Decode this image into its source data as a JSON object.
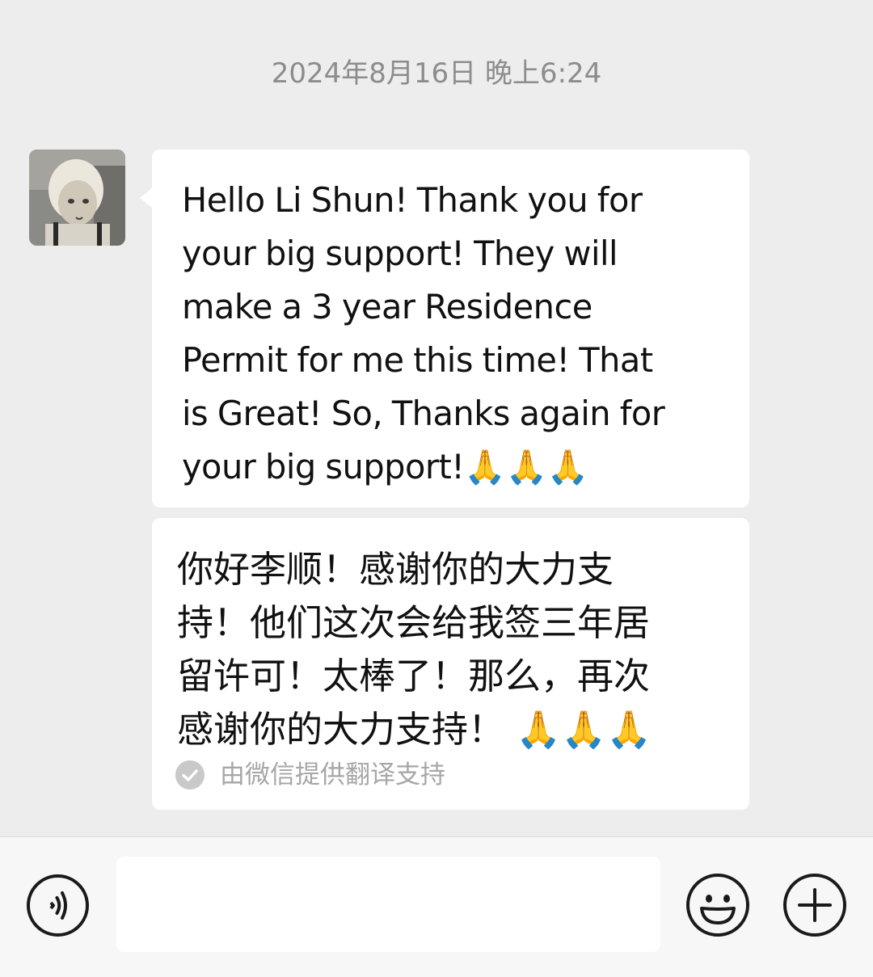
{
  "chat": {
    "timestamp": "2024年8月16日 晚上6:24",
    "message": {
      "text": "Hello Li Shun! Thank you for\nyour big support! They will\nmake a 3 year Residence\nPermit for me this time! That\nis Great! So, Thanks again for\nyour big support!🙏🙏🙏",
      "translation": "你好李顺！感谢你的大力支\n持！他们这次会给我签三年居\n留许可！太棒了！那么，再次\n感谢你的大力支持！ 🙏🙏🙏",
      "translation_credit": "由微信提供翻译支持"
    }
  },
  "input_bar": {
    "input_value": "",
    "voice_icon": "voice-icon",
    "emoji_icon": "emoji-icon",
    "plus_icon": "plus-icon"
  },
  "colors": {
    "background": "#ededed",
    "bubble": "#ffffff",
    "timestamp": "#8c8c8c",
    "credit": "#a6a6a6"
  }
}
